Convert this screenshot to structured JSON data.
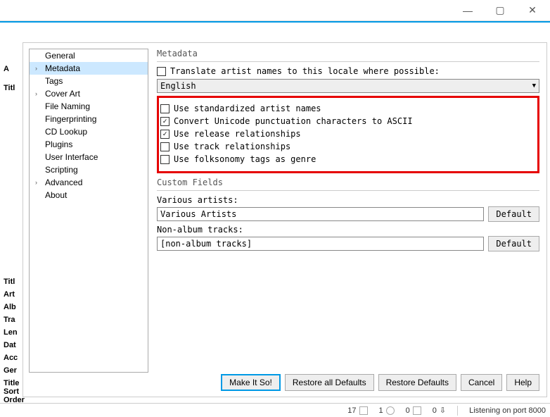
{
  "titlebar": {
    "min": "—",
    "max": "▢",
    "close": "✕"
  },
  "nav": {
    "items": [
      {
        "label": "General",
        "indent": true
      },
      {
        "label": "Metadata",
        "indent": true,
        "caret": true,
        "selected": true
      },
      {
        "label": "Tags",
        "indent": true
      },
      {
        "label": "Cover Art",
        "caret": true,
        "indent": true
      },
      {
        "label": "File Naming",
        "indent": true
      },
      {
        "label": "Fingerprinting",
        "indent": true
      },
      {
        "label": "CD Lookup",
        "indent": true
      },
      {
        "label": "Plugins",
        "indent": true
      },
      {
        "label": "User Interface",
        "indent": true
      },
      {
        "label": "Scripting",
        "indent": true
      },
      {
        "label": "Advanced",
        "caret": true,
        "indent": true
      },
      {
        "label": "About",
        "indent": true
      }
    ]
  },
  "metadata": {
    "section_title": "Metadata",
    "translate": {
      "checked": false,
      "label": "Translate artist names to this locale where possible:"
    },
    "locale_value": "English",
    "options": [
      {
        "checked": false,
        "label": "Use standardized artist names"
      },
      {
        "checked": true,
        "label": "Convert Unicode punctuation characters to ASCII"
      },
      {
        "checked": true,
        "label": "Use release relationships"
      },
      {
        "checked": false,
        "label": "Use track relationships"
      },
      {
        "checked": false,
        "label": "Use folksonomy tags as genre"
      }
    ]
  },
  "custom": {
    "section_title": "Custom Fields",
    "va_label": "Various artists:",
    "va_value": "Various Artists",
    "nat_label": "Non-album tracks:",
    "nat_value": "[non-album tracks]",
    "default_btn": "Default"
  },
  "buttons": {
    "ok": "Make It So!",
    "restore_all": "Restore all Defaults",
    "restore": "Restore Defaults",
    "cancel": "Cancel",
    "help": "Help"
  },
  "left_stubs": [
    "A",
    "Titl",
    "Titl",
    "Art",
    "Alb",
    "Tra",
    "Len",
    "Dat",
    "Acc",
    "Ger",
    "Title Sort Order"
  ],
  "status": {
    "s1": "17",
    "s2": "1",
    "s3": "0",
    "s4": "0",
    "listen": "Listening on port 8000"
  }
}
